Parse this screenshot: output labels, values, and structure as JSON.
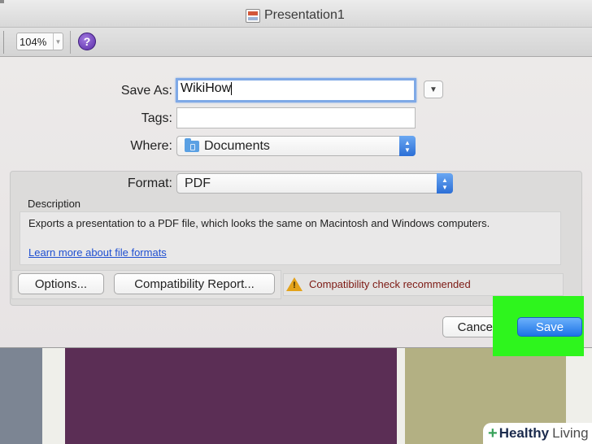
{
  "window": {
    "title": "Presentation1"
  },
  "toolbar": {
    "zoom": "104%",
    "help_glyph": "?"
  },
  "dialog": {
    "save_as": {
      "label": "Save As:",
      "value": "WikiHow"
    },
    "tags": {
      "label": "Tags:",
      "value": ""
    },
    "where": {
      "label": "Where:",
      "value": "Documents"
    },
    "format": {
      "label": "Format:",
      "value": "PDF"
    },
    "description": {
      "heading": "Description",
      "text": "Exports a presentation to a PDF file, which looks the same on Macintosh and Windows computers.",
      "link": "Learn more about file formats"
    },
    "buttons": {
      "options": "Options...",
      "compatibility": "Compatibility Report...",
      "cancel": "Cancel",
      "save": "Save"
    },
    "warning": "Compatibility check recommended"
  },
  "watermark": {
    "plus": "+",
    "healthy": "Healthy",
    "living": "Living"
  },
  "colors": {
    "highlight": "#2ef51d",
    "accent_blue": "#1d73e6",
    "warning_text": "#7d1a14",
    "slide_purple": "#5b2e55",
    "slide_olive": "#b3b083"
  },
  "icons": {
    "document": "presentation-document-icon",
    "help": "help-icon",
    "folder": "folder-icon",
    "warning": "warning-icon",
    "stepper": "up-down-chevron-icon",
    "expand": "chevron-down-icon"
  }
}
